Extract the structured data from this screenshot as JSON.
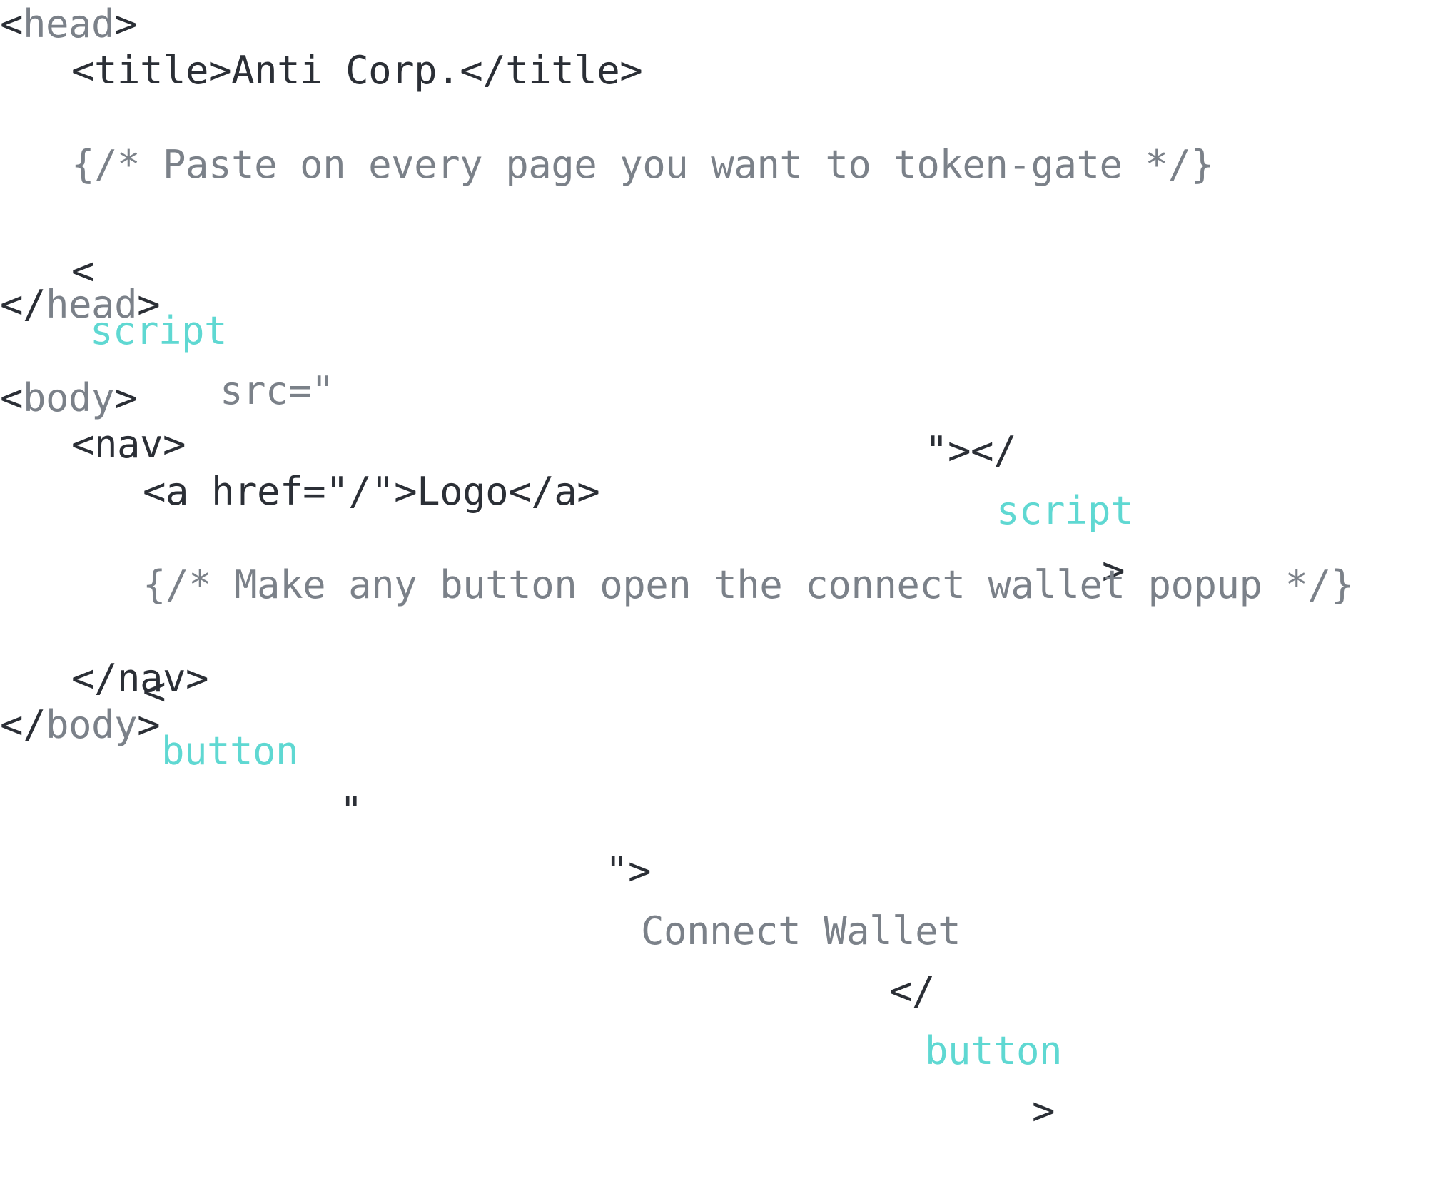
{
  "colors": {
    "background": "#ffffff",
    "text": "#2b2f36",
    "muted": "#7b8189",
    "accent": "#5fd8d2"
  },
  "code": {
    "head_open": {
      "lt": "<",
      "tag": "head",
      "gt": ">"
    },
    "title_line": {
      "open_tag": "<title>",
      "text": "Anti Corp.",
      "close_tag": "</title>"
    },
    "comment_paste": "{/* Paste on every page you want to token-gate */}",
    "script_line": {
      "lt": "<",
      "tag": "script",
      "attr": " src=\"",
      "close_quote": "\"></",
      "close_tag": "script",
      "gt": ">"
    },
    "head_close": {
      "lt": "</",
      "tag": "head",
      "gt": ">"
    },
    "body_open": {
      "lt": "<",
      "tag": "body",
      "gt": ">"
    },
    "nav_open": "<nav>",
    "link_line": {
      "open_tag": "<a href=\"/\">",
      "text": "Logo",
      "close_tag": "</a>"
    },
    "comment_button": "{/* Make any button open the connect wallet popup */}",
    "button_line": {
      "lt": "<",
      "tag": "button",
      "quote_open": "\"",
      "quote_close": "\">",
      "text": "Connect Wallet",
      "close_lt": "</",
      "close_tag": "button",
      "gt": ">"
    },
    "nav_close": "</nav>",
    "body_close": {
      "lt": "</",
      "tag": "body",
      "gt": ">"
    }
  }
}
